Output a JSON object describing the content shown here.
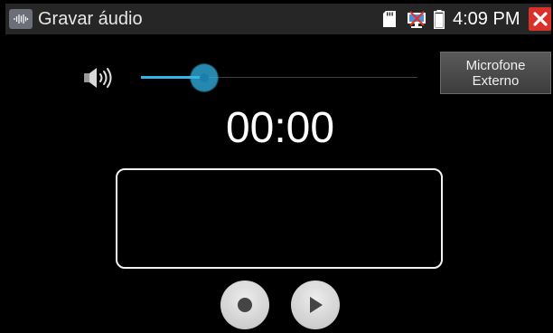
{
  "statusbar": {
    "title": "Gravar áudio",
    "app_icon": "waveform-icon",
    "clock": "4:09 PM",
    "icons": [
      "sd-card-icon",
      "network-icon",
      "battery-icon",
      "close-icon"
    ]
  },
  "volume": {
    "icon": "speaker-icon",
    "level": 0.23,
    "accent_color": "#33b5e5"
  },
  "mic_button": {
    "line1": "Microfone",
    "line2": "Externo"
  },
  "timer": "00:00",
  "controls": {
    "record_icon": "record-icon",
    "play_icon": "play-icon"
  },
  "colors": {
    "close_button": "#d8322a",
    "statusbar": "#262626",
    "background": "#000000"
  }
}
